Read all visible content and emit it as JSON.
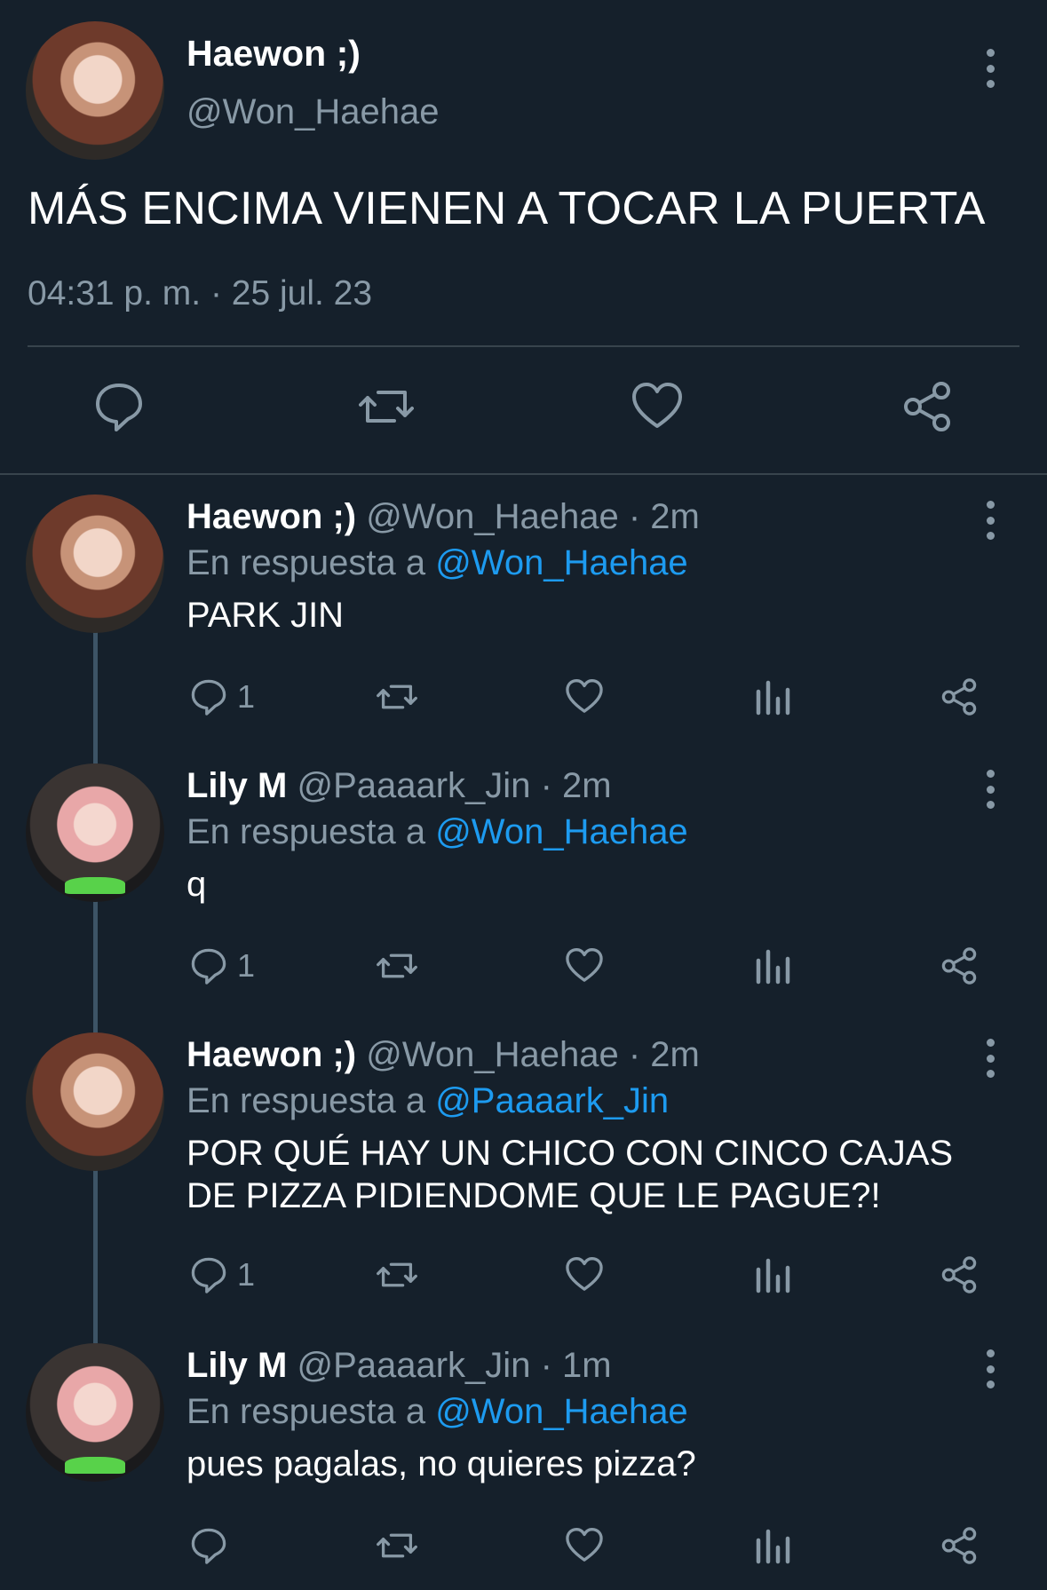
{
  "main_tweet": {
    "name": "Haewon ;)",
    "handle": "@Won_Haehae",
    "text": "MÁS ENCIMA VIENEN A TOCAR LA PUERTA",
    "timestamp": "04:31 p. m. · 25 jul. 23"
  },
  "replies": [
    {
      "name": "Haewon ;)",
      "handle": "@Won_Haehae",
      "time": "· 2m",
      "reply_prefix": "En respuesta a",
      "reply_to": "@Won_Haehae",
      "text": "PARK JIN",
      "reply_count": "1"
    },
    {
      "name": "Lily M",
      "handle": "@Paaaark_Jin",
      "time": "· 2m",
      "reply_prefix": "En respuesta a",
      "reply_to": "@Won_Haehae",
      "text": "q",
      "reply_count": "1"
    },
    {
      "name": "Haewon ;)",
      "handle": "@Won_Haehae",
      "time": "· 2m",
      "reply_prefix": "En respuesta a",
      "reply_to": "@Paaaark_Jin",
      "text": "POR QUÉ HAY UN CHICO CON CINCO CAJAS DE PIZZA PIDIENDOME QUE LE PAGUE?!",
      "reply_count": "1"
    },
    {
      "name": "Lily M",
      "handle": "@Paaaark_Jin",
      "time": "· 1m",
      "reply_prefix": "En respuesta a",
      "reply_to": "@Won_Haehae",
      "text": "pues pagalas, no quieres pizza?",
      "reply_count": ""
    }
  ],
  "colors": {
    "background": "#15202b",
    "text": "#ffffff",
    "muted": "#8899a6",
    "link": "#1d9bf0",
    "divider": "#38444d"
  },
  "icons": [
    "more-icon",
    "reply-icon",
    "retweet-icon",
    "like-icon",
    "share-icon",
    "analytics-icon"
  ]
}
